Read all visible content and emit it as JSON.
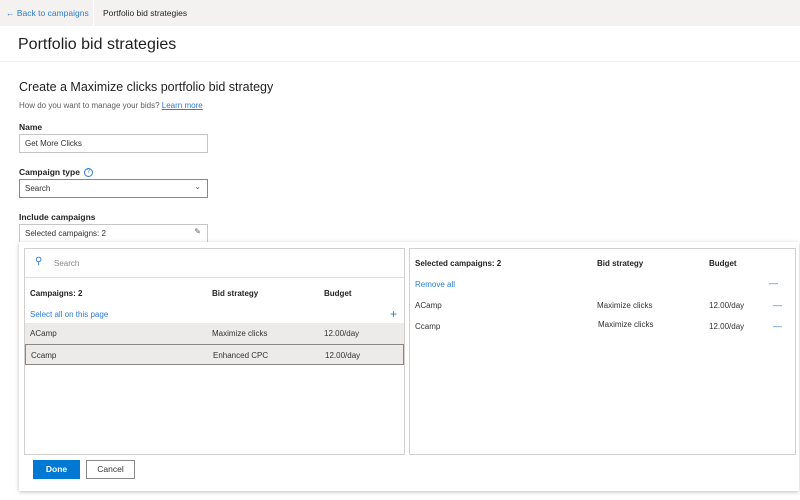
{
  "breadcrumb": {
    "back": "Back to campaigns",
    "current": "Portfolio bid strategies"
  },
  "page_title": "Portfolio bid strategies",
  "form": {
    "heading": "Create a Maximize clicks portfolio bid strategy",
    "subtext": "How do you want to manage your bids?",
    "learn_more": "Learn more",
    "name_label": "Name",
    "name_value": "Get More Clicks",
    "campaign_type_label": "Campaign type",
    "campaign_type_value": "Search",
    "include_label": "Include campaigns",
    "include_value": "Selected campaigns: 2"
  },
  "picker": {
    "search_placeholder": "Search",
    "left": {
      "headers": [
        "Campaigns: 2",
        "Bid strategy",
        "Budget"
      ],
      "select_all": "Select all on this page",
      "rows": [
        {
          "name": "ACamp",
          "strategy": "Maximize clicks",
          "budget": "12.00/day"
        },
        {
          "name": "Ccamp",
          "strategy": "Enhanced CPC",
          "budget": "12.00/day"
        }
      ]
    },
    "right": {
      "headers": [
        "Selected campaigns: 2",
        "Bid strategy",
        "Budget"
      ],
      "remove_all": "Remove all",
      "rows": [
        {
          "name": "ACamp",
          "strategy": "Maximize clicks",
          "budget": "12.00/day"
        },
        {
          "name": "Ccamp",
          "strategy": "Maximize clicks",
          "budget": "12.00/day"
        }
      ]
    },
    "done": "Done",
    "cancel": "Cancel"
  },
  "colors": {
    "accent": "#0078d4",
    "link": "#2b7cd3"
  }
}
